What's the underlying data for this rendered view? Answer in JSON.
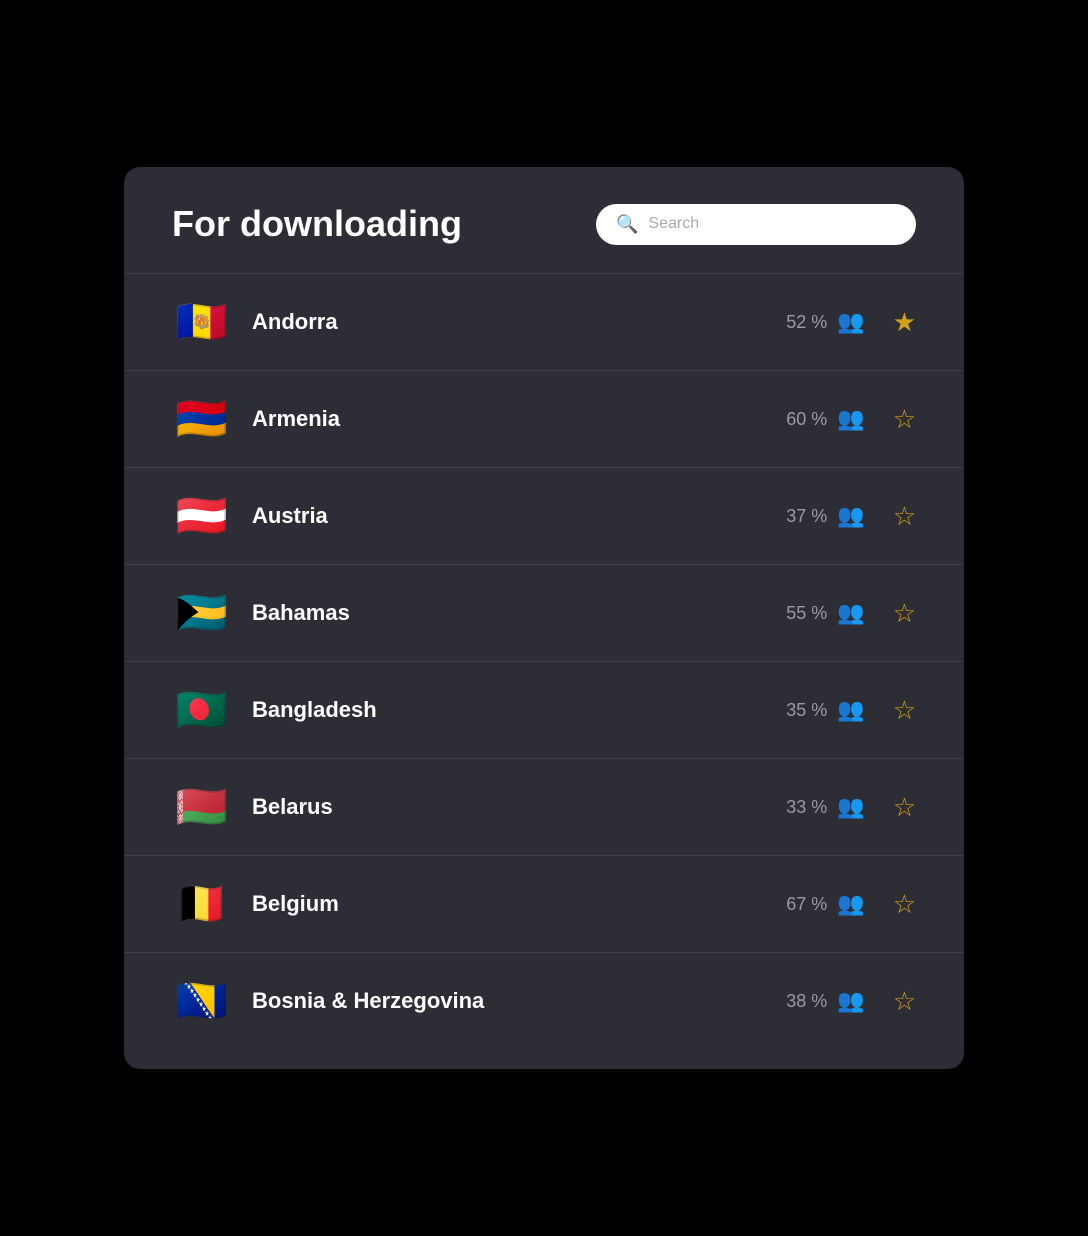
{
  "header": {
    "title": "For downloading",
    "search_placeholder": "Search"
  },
  "countries": [
    {
      "name": "Andorra",
      "percentage": "52 %",
      "flag_emoji": "🇦🇩",
      "star_filled": true,
      "id": "andorra"
    },
    {
      "name": "Armenia",
      "percentage": "60 %",
      "flag_emoji": "🇦🇲",
      "star_filled": false,
      "id": "armenia"
    },
    {
      "name": "Austria",
      "percentage": "37 %",
      "flag_emoji": "🇦🇹",
      "star_filled": false,
      "id": "austria"
    },
    {
      "name": "Bahamas",
      "percentage": "55 %",
      "flag_emoji": "🇧🇸",
      "star_filled": false,
      "id": "bahamas"
    },
    {
      "name": "Bangladesh",
      "percentage": "35 %",
      "flag_emoji": "🇧🇩",
      "star_filled": false,
      "id": "bangladesh"
    },
    {
      "name": "Belarus",
      "percentage": "33 %",
      "flag_emoji": "🇧🇾",
      "star_filled": false,
      "id": "belarus"
    },
    {
      "name": "Belgium",
      "percentage": "67 %",
      "flag_emoji": "🇧🇪",
      "star_filled": false,
      "id": "belgium"
    },
    {
      "name": "Bosnia & Herzegovina",
      "percentage": "38 %",
      "flag_emoji": "🇧🇦",
      "star_filled": false,
      "id": "bosnia"
    }
  ]
}
